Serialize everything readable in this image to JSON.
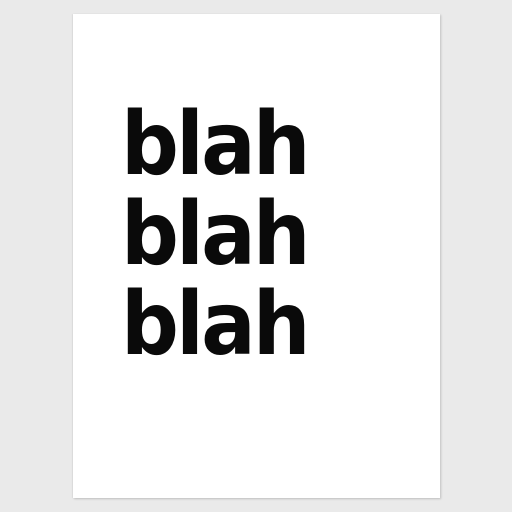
{
  "poster": {
    "lines": [
      "blah",
      "blah",
      "blah"
    ]
  },
  "colors": {
    "background": "#eaeaea",
    "paper": "#ffffff",
    "text": "#0a0a0a"
  }
}
